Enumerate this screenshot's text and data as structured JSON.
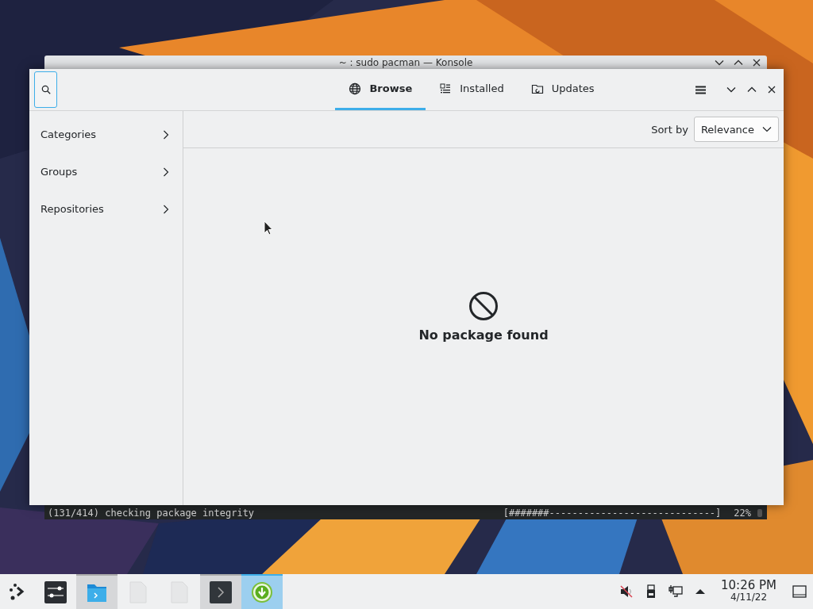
{
  "konsole": {
    "title": "~ : sudo pacman — Konsole",
    "output": "(131/414) checking package integrity",
    "progress_text": "[#######-----------------------------]",
    "percent": "22%"
  },
  "discover": {
    "tabs": [
      {
        "label": "Browse",
        "kind": "globe",
        "selected": true
      },
      {
        "label": "Installed",
        "kind": "list",
        "selected": false
      },
      {
        "label": "Updates",
        "kind": "folder",
        "selected": false
      }
    ],
    "sidebar": {
      "items": [
        {
          "label": "Categories"
        },
        {
          "label": "Groups"
        },
        {
          "label": "Repositories"
        }
      ]
    },
    "sort": {
      "label": "Sort by",
      "value": "Relevance"
    },
    "empty_message": "No package found"
  },
  "taskbar": {
    "tasks": [
      {
        "kind": "sliders",
        "selected": false,
        "open": false
      },
      {
        "kind": "folder",
        "selected": false,
        "open": true
      },
      {
        "kind": "document",
        "selected": false,
        "open": false
      },
      {
        "kind": "document",
        "selected": false,
        "open": false
      },
      {
        "kind": "terminal",
        "selected": false,
        "open": true
      },
      {
        "kind": "download",
        "selected": true,
        "open": true
      }
    ],
    "tray": {
      "time": "10:26 PM",
      "date": "4/11/22"
    }
  }
}
